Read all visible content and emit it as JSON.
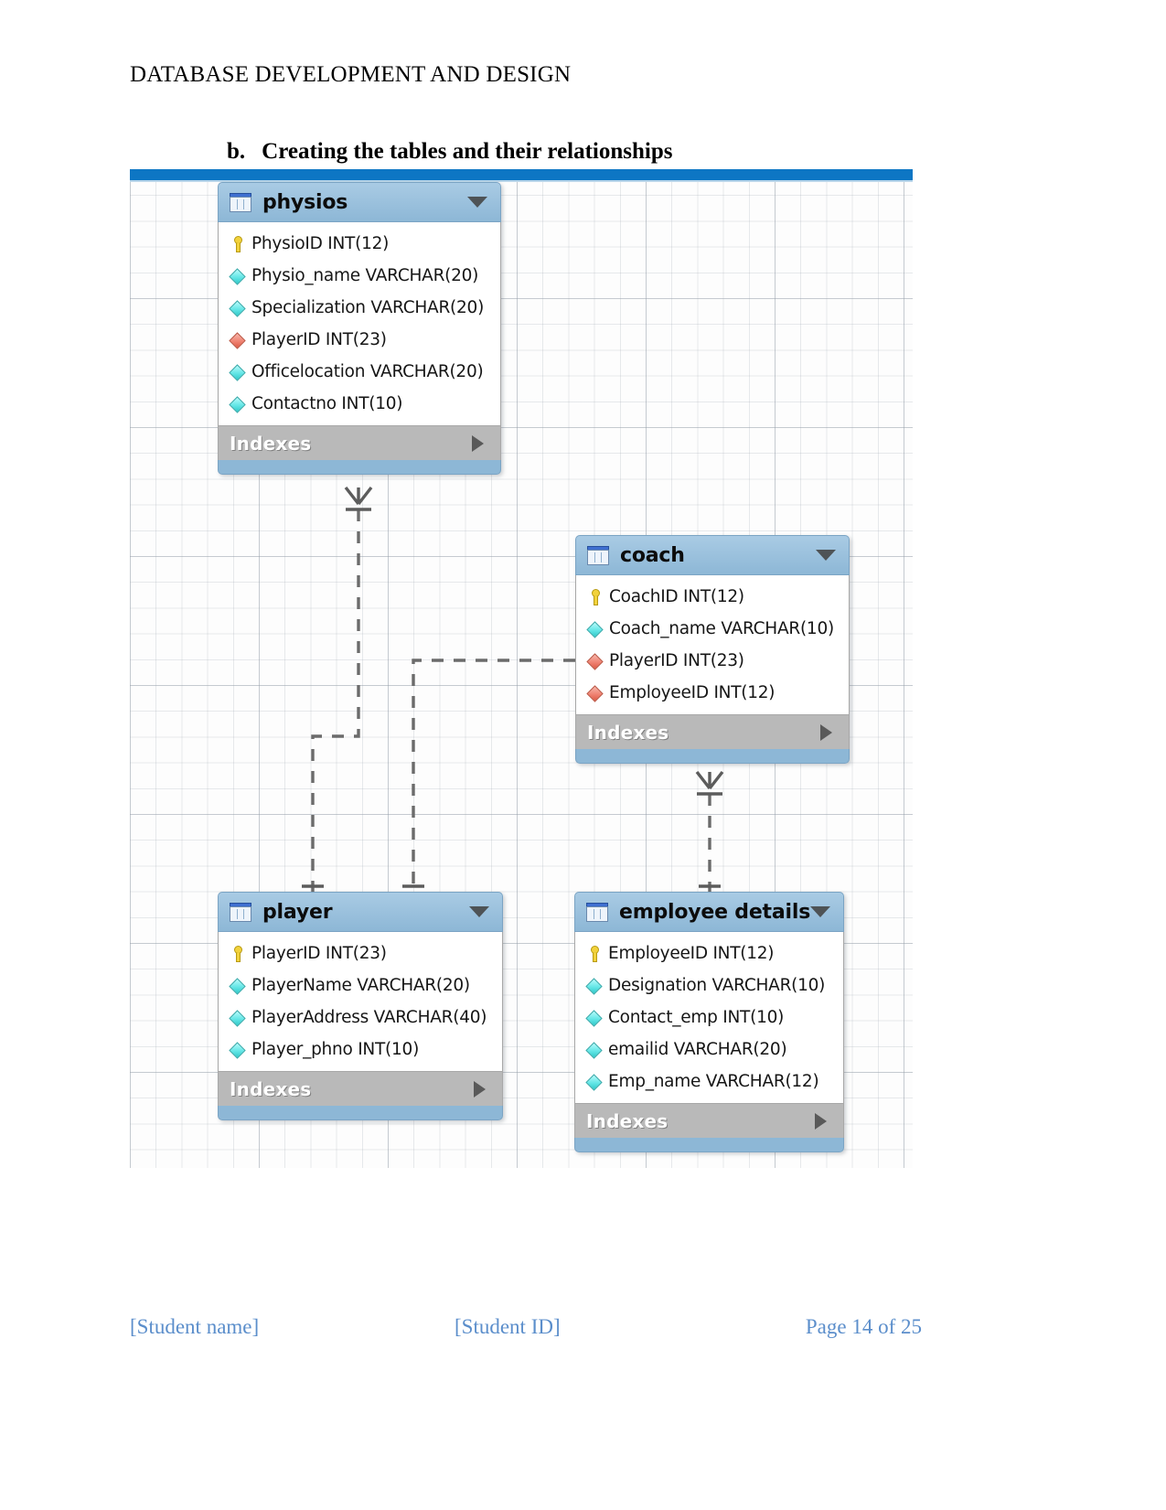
{
  "document": {
    "header_title": "DATABASE DEVELOPMENT AND DESIGN",
    "section": {
      "marker": "b.",
      "heading": "Creating the tables and their relationships"
    }
  },
  "footer": {
    "student_name": "[Student name]",
    "student_id": "[Student ID]",
    "page": "Page 14 of 25"
  },
  "diagram": {
    "top_bar_color": "#0d76c4",
    "header_color": "#8db7d6",
    "indexes_label": "Indexes",
    "tables": [
      {
        "name": "physios",
        "indexes_label": "Indexes",
        "columns": [
          {
            "glyph": "key-icon",
            "text": "PhysioID INT(12)"
          },
          {
            "glyph": "cyan-diamond-icon",
            "text": "Physio_name VARCHAR(20)"
          },
          {
            "glyph": "cyan-diamond-icon",
            "text": "Specialization VARCHAR(20)"
          },
          {
            "glyph": "red-diamond-icon",
            "text": "PlayerID INT(23)"
          },
          {
            "glyph": "cyan-diamond-icon",
            "text": "Officelocation VARCHAR(20)"
          },
          {
            "glyph": "cyan-diamond-icon",
            "text": "Contactno INT(10)"
          }
        ]
      },
      {
        "name": "coach",
        "indexes_label": "Indexes",
        "columns": [
          {
            "glyph": "key-icon",
            "text": "CoachID INT(12)"
          },
          {
            "glyph": "cyan-diamond-icon",
            "text": "Coach_name VARCHAR(10)"
          },
          {
            "glyph": "red-diamond-icon",
            "text": "PlayerID INT(23)"
          },
          {
            "glyph": "red-diamond-icon",
            "text": "EmployeeID INT(12)"
          }
        ]
      },
      {
        "name": "player",
        "indexes_label": "Indexes",
        "columns": [
          {
            "glyph": "key-icon",
            "text": "PlayerID INT(23)"
          },
          {
            "glyph": "cyan-diamond-icon",
            "text": "PlayerName VARCHAR(20)"
          },
          {
            "glyph": "cyan-diamond-icon",
            "text": "PlayerAddress VARCHAR(40)"
          },
          {
            "glyph": "cyan-diamond-icon",
            "text": "Player_phno INT(10)"
          }
        ]
      },
      {
        "name": "employee details",
        "indexes_label": "Indexes",
        "columns": [
          {
            "glyph": "key-icon",
            "text": "EmployeeID INT(12)"
          },
          {
            "glyph": "cyan-diamond-icon",
            "text": "Designation VARCHAR(10)"
          },
          {
            "glyph": "cyan-diamond-icon",
            "text": "Contact_emp INT(10)"
          },
          {
            "glyph": "cyan-diamond-icon",
            "text": "emailid VARCHAR(20)"
          },
          {
            "glyph": "cyan-diamond-icon",
            "text": "Emp_name VARCHAR(12)"
          }
        ]
      }
    ],
    "relationships": [
      {
        "from": "player",
        "to": "physios",
        "notation": "one-to-many"
      },
      {
        "from": "player",
        "to": "coach",
        "notation": "one-to-many"
      },
      {
        "from": "employee details",
        "to": "coach",
        "notation": "one-to-many"
      }
    ]
  }
}
